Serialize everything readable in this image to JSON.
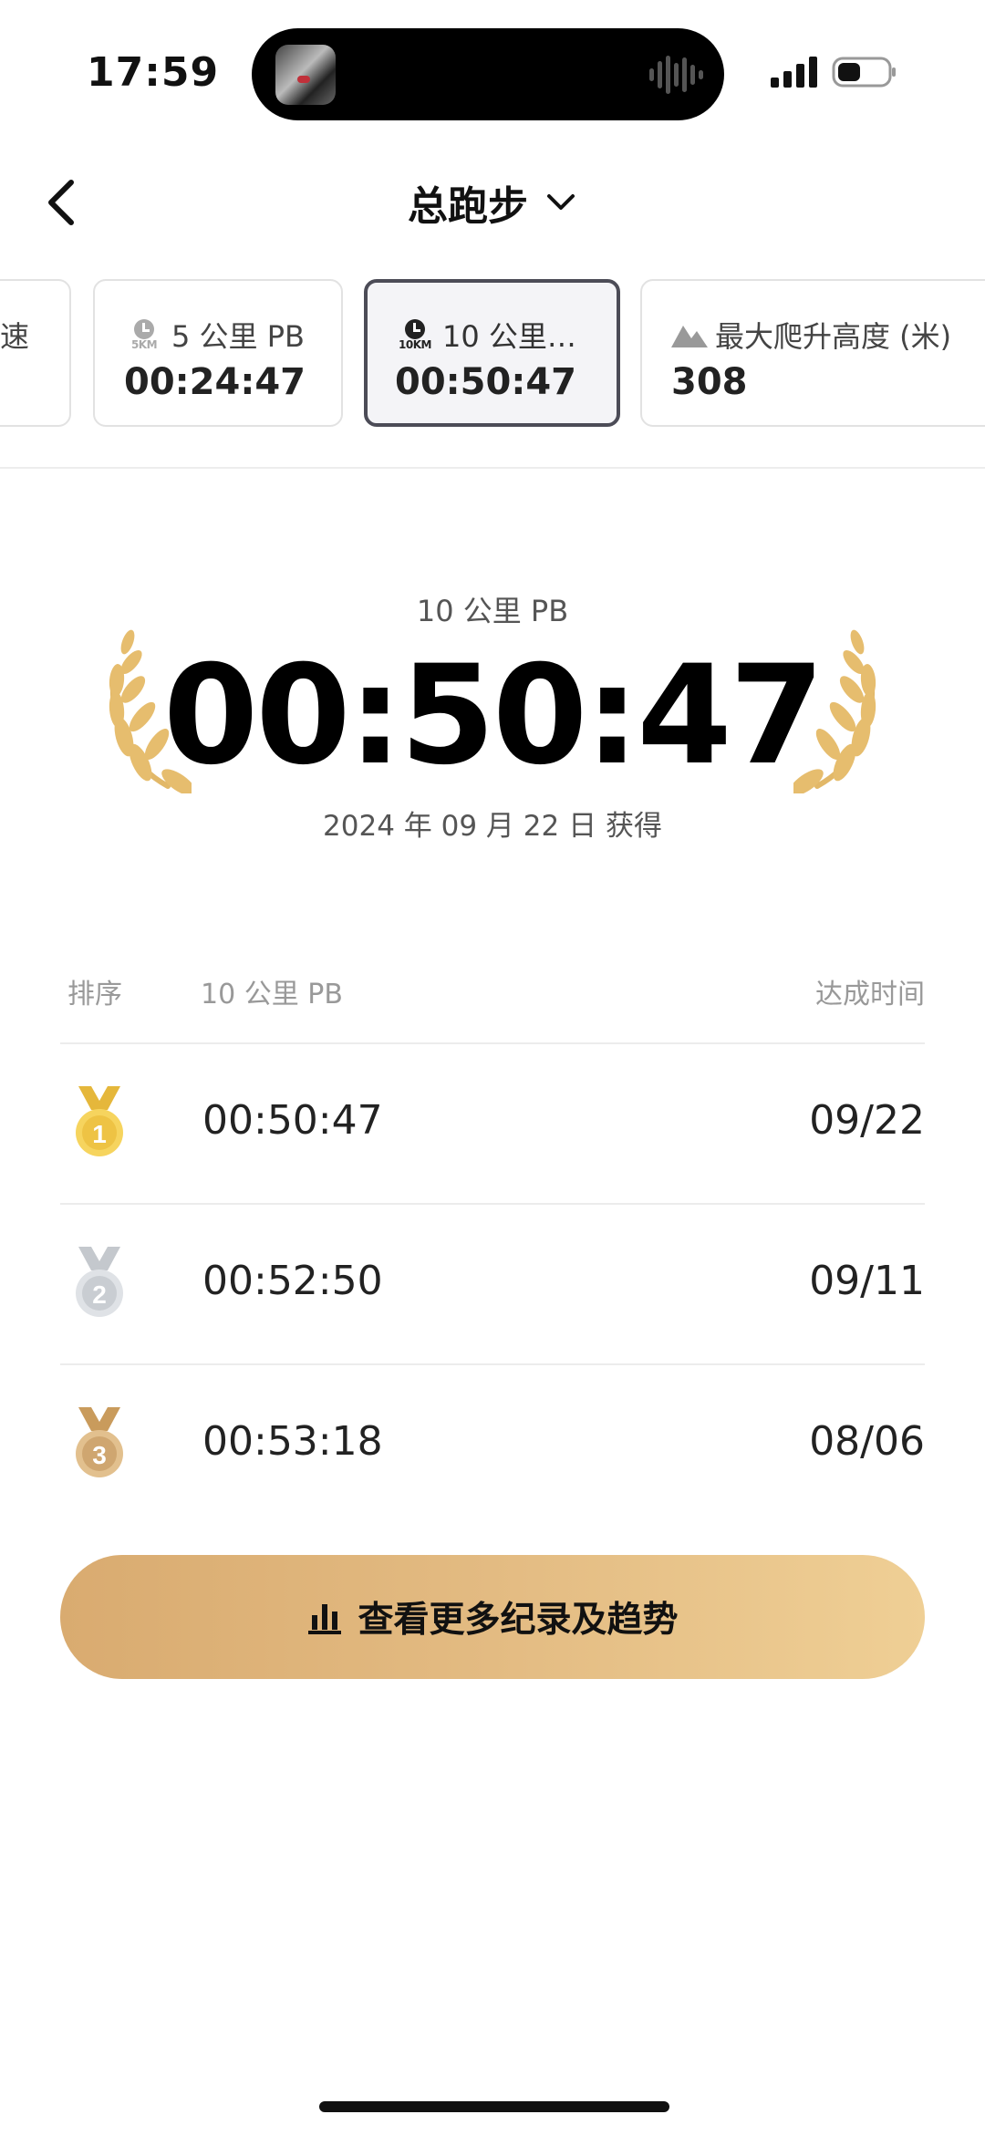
{
  "status": {
    "time": "17:59"
  },
  "header": {
    "title": "总跑步"
  },
  "cards": [
    {
      "label": "速",
      "value": ""
    },
    {
      "label": "5 公里 PB",
      "value": "00:24:47",
      "icon_text": "5KM"
    },
    {
      "label": "10 公里…",
      "value": "00:50:47",
      "icon_text": "10KM",
      "selected": true
    },
    {
      "label": "最大爬升高度 (米)",
      "value": "308"
    }
  ],
  "hero": {
    "label": "10 公里 PB",
    "time": "00:50:47",
    "date": "2024 年 09 月 22 日 获得"
  },
  "table": {
    "col_rank": "排序",
    "col_pb": "10 公里 PB",
    "col_date": "达成时间",
    "rows": [
      {
        "rank": "1",
        "medal": "gold-medal-icon",
        "pb": "00:50:47",
        "date": "09/22"
      },
      {
        "rank": "2",
        "medal": "silver-medal-icon",
        "pb": "00:52:50",
        "date": "09/11"
      },
      {
        "rank": "3",
        "medal": "bronze-medal-icon",
        "pb": "00:53:18",
        "date": "08/06"
      }
    ]
  },
  "cta": {
    "label": "查看更多纪录及趋势",
    "icon": "bar-chart-icon"
  },
  "colors": {
    "gold": "#e5b04a",
    "silver": "#c9cdd2",
    "bronze": "#cfa670",
    "cta_start": "#d9ab70",
    "cta_end": "#efcf95",
    "selected_border": "#4c4c57"
  }
}
